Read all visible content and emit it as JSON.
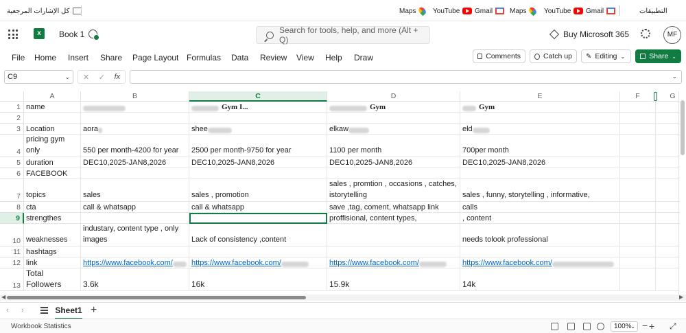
{
  "bookmarks": {
    "all_bookmarks": "كل الإشارات المرجعية",
    "items": [
      {
        "label": "Maps",
        "icon": "maps-icon"
      },
      {
        "label": "YouTube",
        "icon": "youtube-icon"
      },
      {
        "label": "Gmail",
        "icon": "gmail-icon"
      },
      {
        "label": "Maps",
        "icon": "maps-icon"
      },
      {
        "label": "YouTube",
        "icon": "youtube-icon"
      },
      {
        "label": "Gmail",
        "icon": "gmail-icon"
      }
    ],
    "apps": "التطبيقات"
  },
  "titlebar": {
    "book_title": "Book 1",
    "search_placeholder": "Search for tools, help, and more (Alt + Q)",
    "buy": "Buy Microsoft 365",
    "avatar": "MF"
  },
  "ribbon": {
    "tabs": [
      "File",
      "Home",
      "Insert",
      "Share",
      "Page Layout",
      "Formulas",
      "Data",
      "Review",
      "View",
      "Help",
      "Draw"
    ],
    "comments": "Comments",
    "catch_up": "Catch up",
    "editing": "Editing",
    "share": "Share"
  },
  "formula_bar": {
    "name_box": "C9",
    "fx": "fx",
    "value": ""
  },
  "sheet": {
    "columns": [
      "A",
      "B",
      "C",
      "D",
      "E",
      "F",
      "G"
    ],
    "selected_column": "C",
    "selected_row": "9",
    "rows": [
      {
        "n": "1",
        "cells": [
          "name",
          "",
          " Gym I...",
          " Gym",
          " Gym ",
          "",
          ""
        ]
      },
      {
        "n": "2",
        "cells": [
          "",
          "",
          "",
          "",
          "",
          "",
          ""
        ]
      },
      {
        "n": "3",
        "cells": [
          "Location",
          "aora",
          "shee",
          "elkaw",
          "eld",
          "",
          ""
        ]
      },
      {
        "n": "4",
        "cells": [
          "pricing gym only",
          "550 per month-4200 for year",
          "2500 per month-9750 for year",
          "1100 per month",
          "700per month",
          "",
          ""
        ]
      },
      {
        "n": "5",
        "cells": [
          "duration",
          "DEC10,2025-JAN8,2026",
          "DEC10,2025-JAN8,2026",
          "DEC10,2025-JAN8,2026",
          "DEC10,2025-JAN8,2026",
          "",
          ""
        ]
      },
      {
        "n": "6",
        "cells": [
          "FACEBOOK",
          "",
          "",
          "",
          "",
          "",
          ""
        ]
      },
      {
        "n": "7",
        "cells": [
          "topics",
          "sales",
          "sales , promotion",
          "sales , promtion , occasions , catches, istorytelling",
          "sales , funny, storytelling , informative,",
          "",
          ""
        ]
      },
      {
        "n": "8",
        "cells": [
          "cta",
          "call & whatsapp",
          "call & whatsapp",
          "save ,tag, coment, whatsapp link",
          "calls",
          "",
          ""
        ]
      },
      {
        "n": "9",
        "cells": [
          " strengthes",
          "",
          "",
          "proffisional, content types,",
          ", content",
          "",
          ""
        ]
      },
      {
        "n": "10",
        "cells": [
          "weaknesses",
          "industary, content type , only images",
          "Lack of consistency ,content",
          "",
          "needs tolook professional",
          "",
          ""
        ]
      },
      {
        "n": "11",
        "cells": [
          "hashtags",
          "",
          "",
          "",
          "",
          "",
          ""
        ]
      },
      {
        "n": "12",
        "cells": [
          "link",
          "https://www.facebook.com/",
          "https://www.facebook.com/",
          "https://www.facebook.com/",
          "https://www.facebook.com/",
          "",
          ""
        ]
      },
      {
        "n": "13",
        "cells": [
          "Total Followers",
          "3.6k",
          "16k",
          "15.9k",
          "14k",
          "",
          ""
        ]
      }
    ]
  },
  "sheet_tabs": {
    "active": "Sheet1"
  },
  "status": {
    "left": "Workbook Statistics",
    "zoom": "100%"
  }
}
